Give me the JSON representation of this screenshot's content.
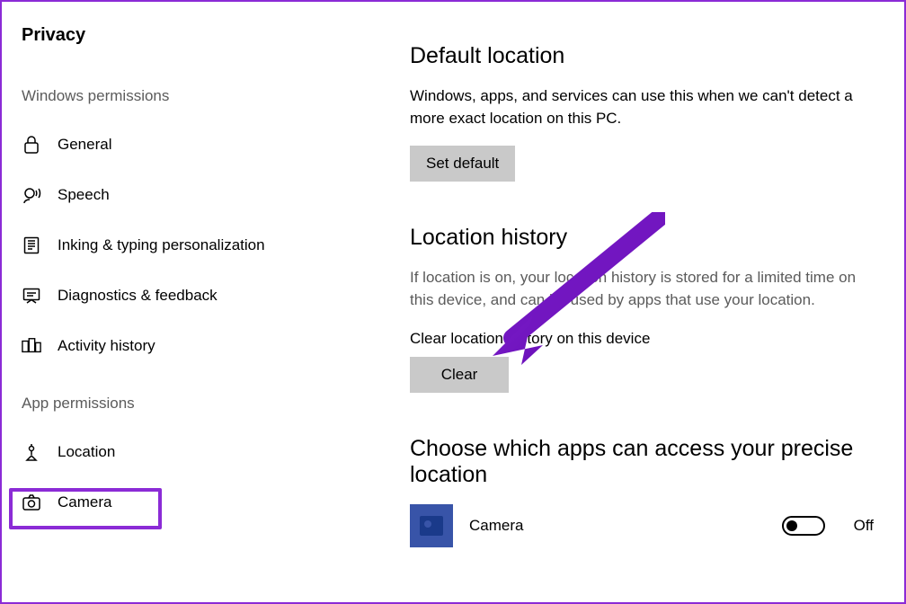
{
  "title": "Privacy",
  "sidebar": {
    "sections": [
      {
        "header": "Windows permissions",
        "items": [
          {
            "id": "general",
            "label": "General",
            "icon": "lock-icon"
          },
          {
            "id": "speech",
            "label": "Speech",
            "icon": "speech-icon"
          },
          {
            "id": "inking",
            "label": "Inking & typing personalization",
            "icon": "inking-icon"
          },
          {
            "id": "diagnostics",
            "label": "Diagnostics & feedback",
            "icon": "feedback-icon"
          },
          {
            "id": "activity",
            "label": "Activity history",
            "icon": "activity-icon"
          }
        ]
      },
      {
        "header": "App permissions",
        "items": [
          {
            "id": "location",
            "label": "Location",
            "icon": "location-icon"
          },
          {
            "id": "camera",
            "label": "Camera",
            "icon": "camera-icon"
          }
        ]
      }
    ]
  },
  "content": {
    "default_location": {
      "title": "Default location",
      "desc": "Windows, apps, and services can use this when we can't detect a more exact location on this PC.",
      "button": "Set default"
    },
    "location_history": {
      "title": "Location history",
      "desc": "If location is on, your location history is stored for a limited time on this device, and can be used by apps that use your location.",
      "clear_label": "Clear location history on this device",
      "clear_button": "Clear"
    },
    "choose_apps": {
      "title": "Choose which apps can access your precise location",
      "apps": [
        {
          "name": "Camera",
          "state": "Off"
        }
      ]
    }
  }
}
